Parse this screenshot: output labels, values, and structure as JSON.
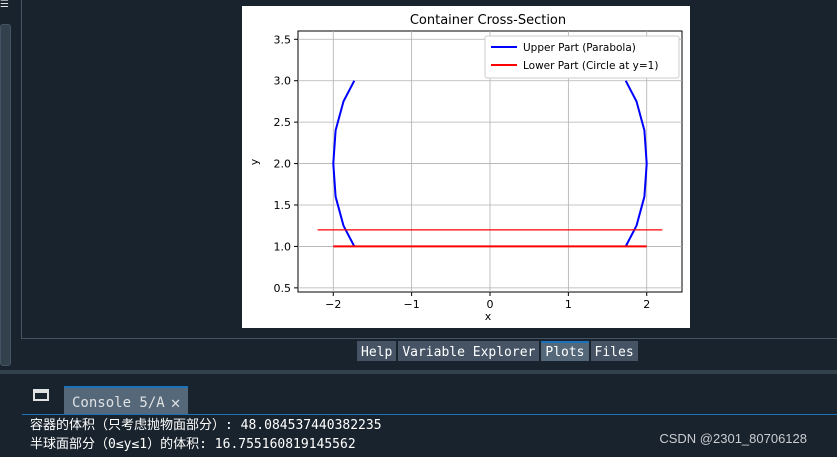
{
  "plot": {
    "title": "Container Cross-Section",
    "xlabel": "x",
    "ylabel": "y",
    "legend": [
      {
        "label": "Upper Part (Parabola)",
        "color": "#0000ff"
      },
      {
        "label": "Lower Part (Circle at y=1)",
        "color": "#ff0000"
      }
    ]
  },
  "chart_data": {
    "type": "line",
    "title": "Container Cross-Section",
    "xlabel": "x",
    "ylabel": "y",
    "xlim": [
      -2.45,
      2.45
    ],
    "ylim": [
      0.45,
      3.6
    ],
    "xticks": [
      -2,
      -1,
      0,
      1,
      2
    ],
    "yticks": [
      0.5,
      1.0,
      1.5,
      2.0,
      2.5,
      3.0,
      3.5
    ],
    "xtick_labels": [
      "−2",
      "−1",
      "0",
      "1",
      "2"
    ],
    "ytick_labels": [
      "0.5",
      "1.0",
      "1.5",
      "2.0",
      "2.5",
      "3.0",
      "3.5"
    ],
    "grid": true,
    "legend_position": "upper right",
    "series": [
      {
        "name": "Upper Part (Parabola)",
        "color": "#0000ff",
        "segments": [
          {
            "x": [
              -1.732,
              -1.87,
              -1.97,
              -2.0,
              -1.97,
              -1.87,
              -1.732
            ],
            "y": [
              1.0,
              1.25,
              1.6,
              2.0,
              2.4,
              2.75,
              3.0
            ]
          },
          {
            "x": [
              1.732,
              1.87,
              1.97,
              2.0,
              1.97,
              1.87,
              1.732
            ],
            "y": [
              1.0,
              1.25,
              1.6,
              2.0,
              2.4,
              2.75,
              3.0
            ]
          }
        ]
      },
      {
        "name": "Lower Part (Circle at y=1)",
        "color": "#ff0000",
        "segments": [
          {
            "x": [
              -2.0,
              2.0
            ],
            "y": [
              1.0,
              1.0
            ]
          }
        ]
      },
      {
        "name": "",
        "color": "#ff0000",
        "segments": [
          {
            "x": [
              -2.2,
              2.2
            ],
            "y": [
              1.2,
              1.2
            ]
          }
        ]
      }
    ]
  },
  "tabs": [
    {
      "label": "Help",
      "active": false
    },
    {
      "label": "Variable Explorer",
      "active": false
    },
    {
      "label": "Plots",
      "active": true
    },
    {
      "label": "Files",
      "active": false
    }
  ],
  "console": {
    "tab_label": "Console 5/A",
    "close_icon": "close-icon",
    "lines": [
      "容器的体积（只考虑抛物面部分）: 48.084537440382235",
      "半球面部分（0≤y≤1）的体积: 16.755160819145562"
    ]
  },
  "watermark": "CSDN @2301_80706128",
  "colors": {
    "background": "#19232d",
    "tab": "#455364",
    "accent": "#1a72bb"
  }
}
